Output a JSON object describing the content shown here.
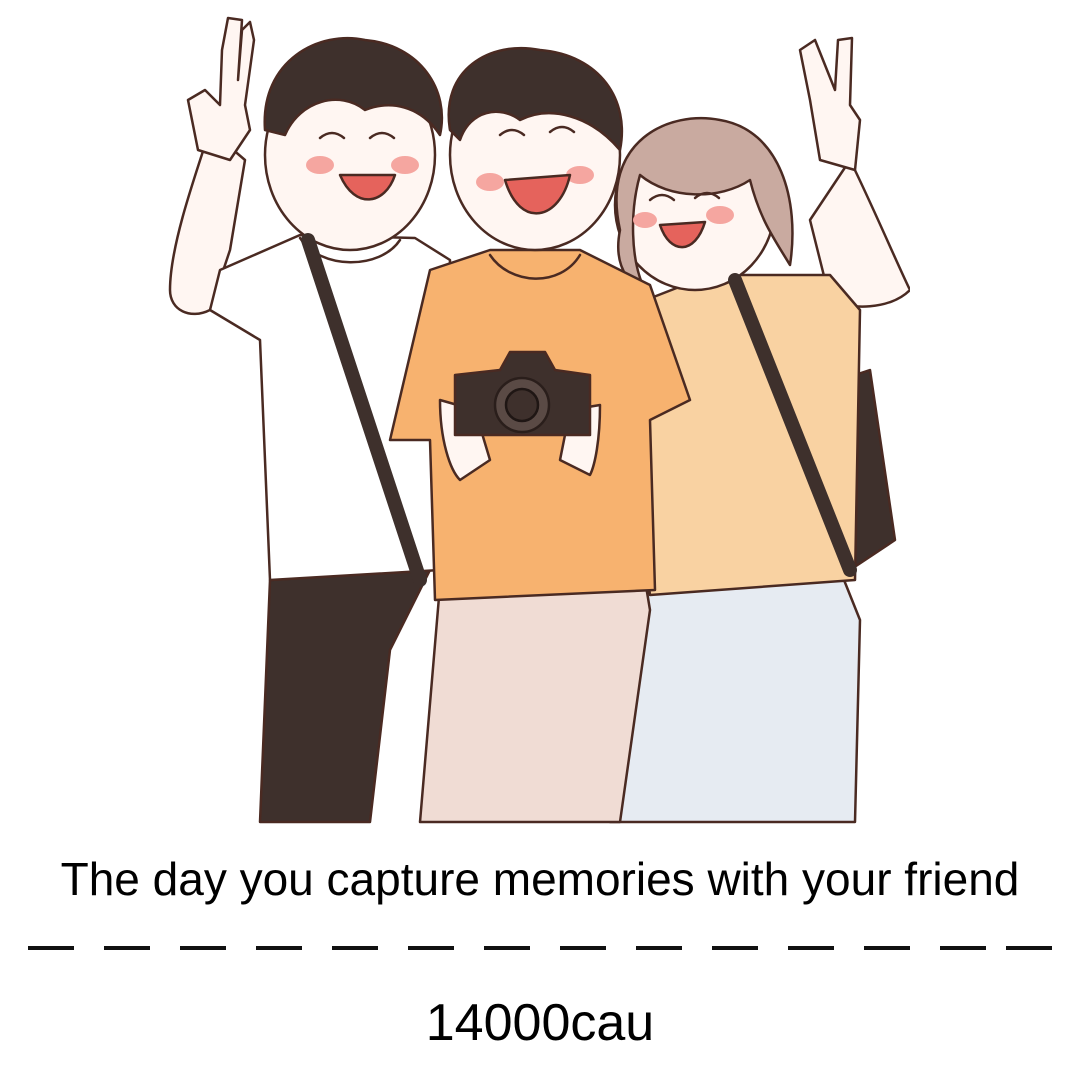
{
  "caption": "The day you capture memories with your friend",
  "watermark": "14000cau",
  "illustration": {
    "subject": "three friends posing with a camera",
    "icons": [
      "peace-sign-hand-icon",
      "camera-icon",
      "backpack-icon"
    ]
  },
  "colors": {
    "orange_shirt": "#f7b26f",
    "peach_shirt": "#f9d2a2",
    "dark": "#3e302c",
    "skin": "#fff6f2",
    "line": "#4a2a22",
    "blush": "#f5a6a0",
    "jeans": "#e6ebf2",
    "beige_pants": "#f0dcd4",
    "hair_light": "#c9aaa0"
  },
  "dash_count": 14
}
